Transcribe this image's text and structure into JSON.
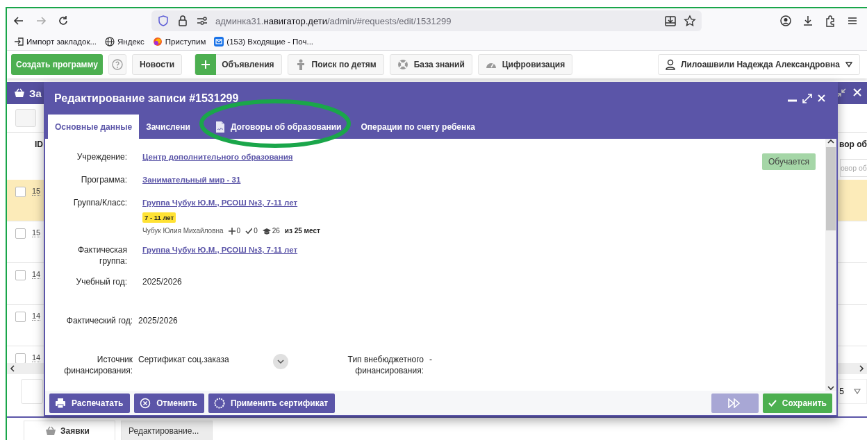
{
  "browser": {
    "url": {
      "prefix": "админка31.",
      "host": "навигатор.дети",
      "path": "/admin/#requests/edit/1531299"
    }
  },
  "bookmarks": [
    {
      "label": "Импорт закладок..."
    },
    {
      "label": "Яндекс"
    },
    {
      "label": "Приступим"
    },
    {
      "label": "(153) Входящие - Поч..."
    }
  ],
  "app_toolbar": {
    "create_button": "Создать программу",
    "buttons": [
      {
        "label": "Новости",
        "kind": "plain"
      },
      {
        "label": "Объявления",
        "kind": "plus"
      },
      {
        "label": "Поиск по детям",
        "kind": "person"
      },
      {
        "label": "База знаний",
        "kind": "lifebuoy"
      },
      {
        "label": "Цифровизация",
        "kind": "gauge"
      }
    ],
    "user": "Лилоашвили Надежда Александровна"
  },
  "background_window": {
    "title": "За",
    "columns": [
      "ID",
      "вор об"
    ],
    "filter_placeholder": "овор об",
    "rows": [
      {
        "id": "15",
        "selected": true
      },
      {
        "id": "15",
        "selected": false
      },
      {
        "id": "14",
        "selected": false
      },
      {
        "id": "14",
        "selected": false
      },
      {
        "id": "14",
        "selected": false
      }
    ],
    "page_size": "5"
  },
  "modal": {
    "title": "Редактирование записи #1531299",
    "tabs": [
      {
        "label": "Основные данные",
        "selected": true
      },
      {
        "label": "Зачислени",
        "selected": false
      },
      {
        "label": "Договоры об образовании",
        "selected": false
      },
      {
        "label": "Операции по счету ребенка",
        "selected": false
      }
    ],
    "status_badge": "Обучается",
    "fields": [
      {
        "kind": "link",
        "label": "Учреждение:",
        "value": "Центр дополнительного образования"
      },
      {
        "kind": "link",
        "label": "Программа:",
        "value": "Занимательный мир - 31"
      },
      {
        "kind": "group",
        "label": "Группа/Класс:",
        "value": "Группа Чубук Ю.М., РСОШ №3, 7-11 лет",
        "age_badge": "7 - 11 лет",
        "teacher": "Чубук Юлия Михайловна",
        "stats": [
          "0",
          "0",
          "26"
        ],
        "capacity": "из 25 мест"
      },
      {
        "kind": "link",
        "label": "Фактическая группа:",
        "value": "Группа Чубук Ю.М., РСОШ №3, 7-11 лет"
      },
      {
        "kind": "text",
        "label": "Учебный год:",
        "value": "2025/2026"
      },
      {
        "kind": "text",
        "label": "Фактический год:",
        "value": "2025/2026"
      },
      {
        "kind": "select",
        "label": "Источник финансирования:",
        "value": "Сертификат соц.заказа",
        "extra_label": "Тип внебюджетного финансирования:",
        "extra_value": "-"
      }
    ],
    "footer": {
      "buttons": [
        "Распечатать",
        "Отменить",
        "Применить сертификат"
      ],
      "next_disabled": true,
      "save": "Сохранить"
    }
  },
  "taskbar": [
    {
      "label": "Заявки",
      "selected": false
    },
    {
      "label": "Редактирование...",
      "selected": true
    }
  ],
  "annotation": {
    "kind": "ellipse",
    "color": "#1aa64a"
  }
}
